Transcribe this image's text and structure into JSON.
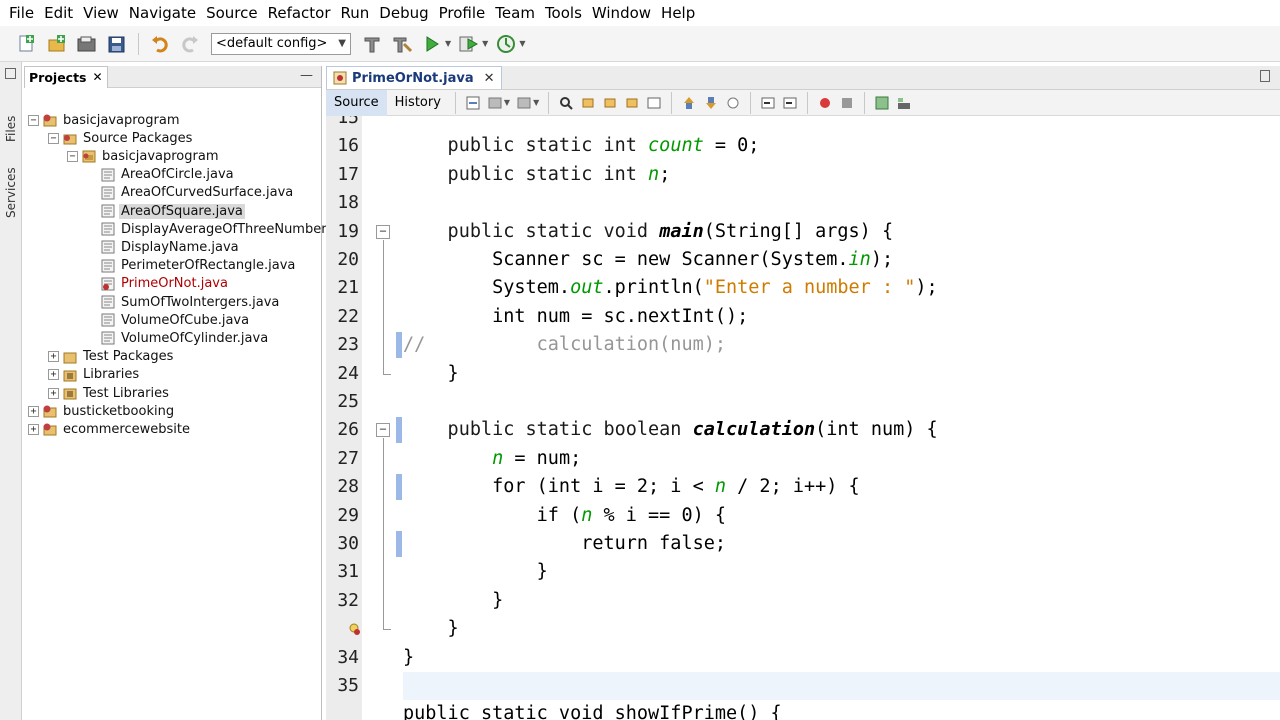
{
  "menu": [
    "File",
    "Edit",
    "View",
    "Navigate",
    "Source",
    "Refactor",
    "Run",
    "Debug",
    "Profile",
    "Team",
    "Tools",
    "Window",
    "Help"
  ],
  "toolbar": {
    "config": "<default config>",
    "icons": [
      "new-file-icon",
      "new-project-icon",
      "open-project-icon",
      "save-all-icon",
      "undo-icon",
      "redo-icon",
      "build-icon",
      "clean-build-icon",
      "run-icon",
      "debug-icon",
      "profile-icon"
    ]
  },
  "side_tabs": {
    "files": "Files",
    "services": "Services"
  },
  "projects": {
    "tab_label": "Projects",
    "tree": [
      {
        "label": "basicjavaprogram",
        "level": 0,
        "expander": "−",
        "icon": "project"
      },
      {
        "label": "Source Packages",
        "level": 1,
        "expander": "−",
        "icon": "source-packages"
      },
      {
        "label": "basicjavaprogram",
        "level": 2,
        "expander": "−",
        "icon": "package"
      },
      {
        "label": "AreaOfCircle.java",
        "level": 3,
        "icon": "java-file"
      },
      {
        "label": "AreaOfCurvedSurface.java",
        "level": 3,
        "icon": "java-file"
      },
      {
        "label": "AreaOfSquare.java",
        "level": 3,
        "icon": "java-file",
        "selected": true
      },
      {
        "label": "DisplayAverageOfThreeNumbers.j",
        "level": 3,
        "icon": "java-file"
      },
      {
        "label": "DisplayName.java",
        "level": 3,
        "icon": "java-file"
      },
      {
        "label": "PerimeterOfRectangle.java",
        "level": 3,
        "icon": "java-file"
      },
      {
        "label": "PrimeOrNot.java",
        "level": 3,
        "icon": "java-file-error",
        "active": true
      },
      {
        "label": "SumOfTwoIntergers.java",
        "level": 3,
        "icon": "java-file"
      },
      {
        "label": "VolumeOfCube.java",
        "level": 3,
        "icon": "java-file"
      },
      {
        "label": "VolumeOfCylinder.java",
        "level": 3,
        "icon": "java-file"
      },
      {
        "label": "Test Packages",
        "level": 1,
        "expander": "+",
        "icon": "folder"
      },
      {
        "label": "Libraries",
        "level": 1,
        "expander": "+",
        "icon": "library"
      },
      {
        "label": "Test Libraries",
        "level": 1,
        "expander": "+",
        "icon": "library"
      },
      {
        "label": "busticketbooking",
        "level": 0,
        "expander": "+",
        "icon": "project"
      },
      {
        "label": "ecommercewebsite",
        "level": 0,
        "expander": "+",
        "icon": "project"
      }
    ]
  },
  "editor": {
    "tab_label": "PrimeOrNot.java",
    "mode_source": "Source",
    "mode_history": "History",
    "lines": [
      {
        "n": "15",
        "segs": []
      },
      {
        "n": "16",
        "segs": [
          [
            "kw",
            "    public static int "
          ],
          [
            "fld",
            "count"
          ],
          [
            "",
            " = 0;"
          ]
        ]
      },
      {
        "n": "17",
        "segs": [
          [
            "kw",
            "    public static int "
          ],
          [
            "fld",
            "n"
          ],
          [
            "",
            ";"
          ]
        ]
      },
      {
        "n": "18",
        "segs": []
      },
      {
        "n": "19",
        "segs": [
          [
            "kw",
            "    public static void "
          ],
          [
            "mth",
            "main"
          ],
          [
            "",
            "(String[] args) {"
          ]
        ],
        "fold": true
      },
      {
        "n": "20",
        "segs": [
          [
            "",
            "        Scanner sc = new Scanner(System."
          ],
          [
            "fld",
            "in"
          ],
          [
            "",
            ");"
          ]
        ]
      },
      {
        "n": "21",
        "segs": [
          [
            "",
            "        System."
          ],
          [
            "fld",
            "out"
          ],
          [
            "",
            ".println("
          ],
          [
            "str",
            "\"Enter a number : \""
          ],
          [
            "",
            ");"
          ]
        ]
      },
      {
        "n": "22",
        "segs": [
          [
            "",
            "        int num = sc.nextInt();"
          ]
        ]
      },
      {
        "n": "23",
        "segs": [
          [
            "cmt",
            "//          calculation(num);"
          ]
        ],
        "change": true,
        "comment": true
      },
      {
        "n": "24",
        "segs": [
          [
            "",
            "    }"
          ]
        ]
      },
      {
        "n": "25",
        "segs": []
      },
      {
        "n": "26",
        "segs": [
          [
            "kw",
            "    public static boolean "
          ],
          [
            "mth",
            "calculation"
          ],
          [
            "",
            "(int num) {"
          ]
        ],
        "fold": true,
        "change": true
      },
      {
        "n": "27",
        "segs": [
          [
            "",
            "        "
          ],
          [
            "fld",
            "n"
          ],
          [
            "",
            " = num;"
          ]
        ]
      },
      {
        "n": "28",
        "segs": [
          [
            "",
            "        for (int i = 2; i < "
          ],
          [
            "fld",
            "n"
          ],
          [
            "",
            " / 2; i++) {"
          ]
        ],
        "change": true
      },
      {
        "n": "29",
        "segs": [
          [
            "",
            "            if ("
          ],
          [
            "fld",
            "n"
          ],
          [
            "",
            " % i == 0) {"
          ]
        ]
      },
      {
        "n": "30",
        "segs": [
          [
            "",
            "                return false;"
          ]
        ],
        "change": true
      },
      {
        "n": "31",
        "segs": [
          [
            "",
            "            }"
          ]
        ]
      },
      {
        "n": "32",
        "segs": [
          [
            "",
            "        }"
          ]
        ]
      },
      {
        "n": "",
        "segs": [
          [
            "",
            "    }"
          ]
        ],
        "error": true
      },
      {
        "n": "34",
        "segs": [
          [
            "",
            "}"
          ]
        ]
      },
      {
        "n": "35",
        "segs": [],
        "current": true
      },
      {
        "n": "",
        "segs": [
          [
            "",
            "public static void showIfPrime() {"
          ]
        ],
        "partial": true
      }
    ]
  }
}
